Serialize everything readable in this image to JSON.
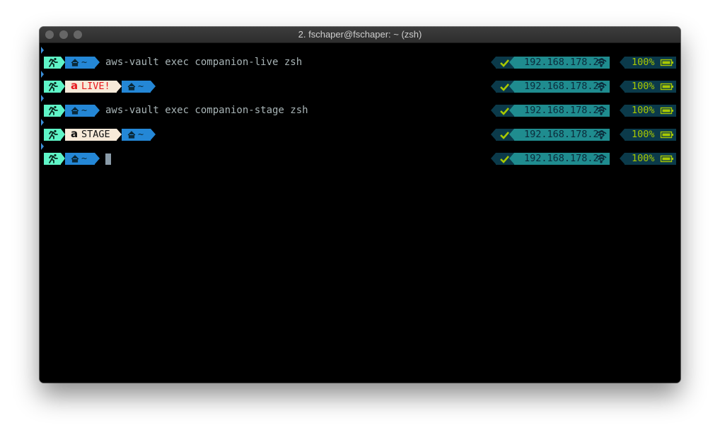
{
  "window": {
    "title": "2. fschaper@fschaper: ~ (zsh)"
  },
  "colors": {
    "context_bg": "#5ff5c7",
    "dir_bg": "#2487d6",
    "aws_bg": "#f7ead9",
    "live_text": "#e8191e",
    "stage_text": "#111111",
    "status_bg": "#0b3a4a",
    "ip_bg": "#1f8c8f",
    "battery_text": "#a8c800",
    "cmd_text": "#a8b4b6"
  },
  "icons": {
    "context": "running-man-icon",
    "home": "home-icon",
    "aws": "amazon-a-icon",
    "status": "checkmark-icon",
    "wifi": "wifi-icon",
    "battery": "battery-icon"
  },
  "lines": [
    {
      "dir": "~",
      "aws": "",
      "command": "aws-vault exec companion-live zsh",
      "ip": "192.168.178.20",
      "battery": "100%"
    },
    {
      "dir": "~",
      "aws": "LIVE!",
      "command": "",
      "ip": "192.168.178.20",
      "battery": "100%"
    },
    {
      "dir": "~",
      "aws": "",
      "command": "aws-vault exec companion-stage zsh",
      "ip": "192.168.178.20",
      "battery": "100%"
    },
    {
      "dir": "~",
      "aws": "STAGE",
      "command": "",
      "ip": "192.168.178.20",
      "battery": "100%"
    },
    {
      "dir": "~",
      "aws": "",
      "command": "",
      "ip": "192.168.178.20",
      "battery": "100%"
    }
  ]
}
